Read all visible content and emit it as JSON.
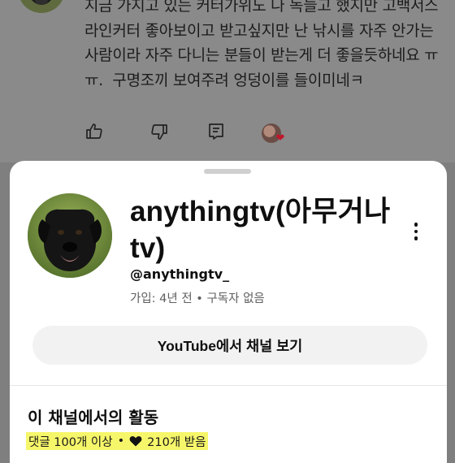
{
  "comment": {
    "text": "지금 가지고 있는 커터가위도 나 독늘고 했지만 고백서스 라인커터 좋아보이고 받고싶지만 난 낚시를 자주 안가는 사람이라 자주 다니는 분들이 받는게 더 좋을듯하네요 ㅠㅠ.  구명조끼 보여주려 엉덩이를 들이미네ㅋ",
    "actions": {
      "like_icon": "thumbs-up-icon",
      "dislike_icon": "thumbs-down-icon",
      "reply_icon": "comment-icon"
    }
  },
  "sheet": {
    "channel_name": "anythingtv(아무거나tv)",
    "handle": "@anythingtv_",
    "meta": "가입: 4년 전 • 구독자 없음",
    "view_button_label": "YouTube에서 채널 보기",
    "activity_heading": "이 채널에서의 활동",
    "activity": {
      "comments": "댓글 100개 이상",
      "separator": "•",
      "likes": "210개 받음"
    }
  },
  "colors": {
    "highlight": "#f6f66a",
    "dim_background": "#8a8a8a",
    "sheet_background": "#ffffff",
    "button_background": "#f2f2f2",
    "meta_text": "#606060"
  }
}
